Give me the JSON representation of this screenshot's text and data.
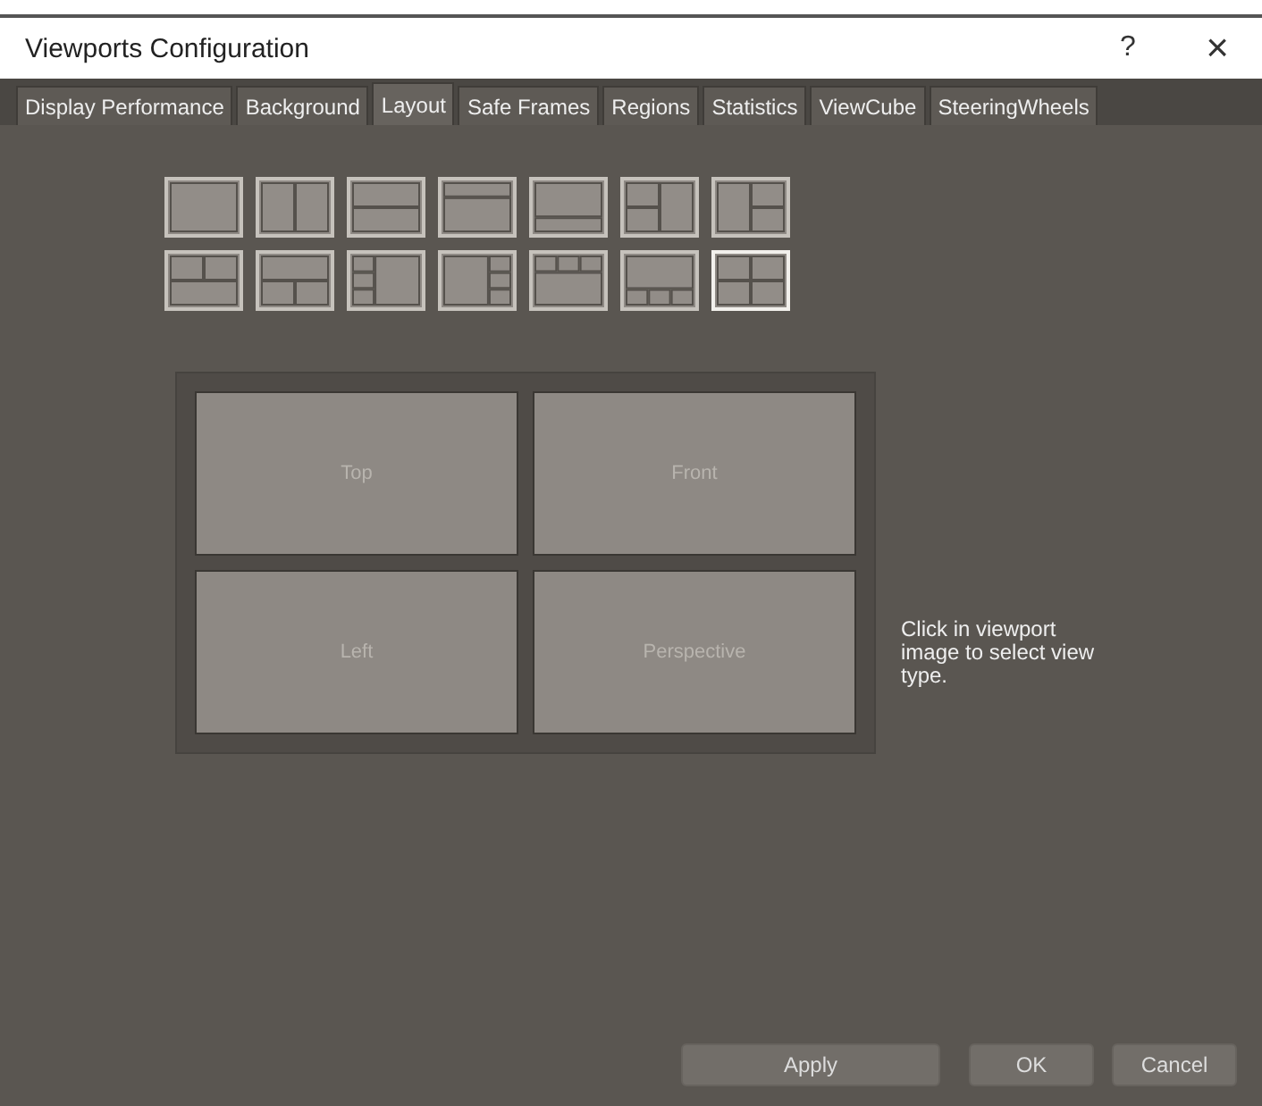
{
  "window": {
    "title": "Viewports Configuration",
    "help": "?",
    "close": "×"
  },
  "tabs": [
    {
      "label": "Display Performance",
      "selected": false
    },
    {
      "label": "Background",
      "selected": false
    },
    {
      "label": "Layout",
      "selected": true
    },
    {
      "label": "Safe Frames",
      "selected": false
    },
    {
      "label": "Regions",
      "selected": false
    },
    {
      "label": "Statistics",
      "selected": false
    },
    {
      "label": "ViewCube",
      "selected": false
    },
    {
      "label": "SteeringWheels",
      "selected": false
    }
  ],
  "layouts": [
    {
      "kind": "single",
      "selected": false
    },
    {
      "kind": "two-columns",
      "selected": false
    },
    {
      "kind": "two-rows",
      "selected": false
    },
    {
      "kind": "small-top",
      "selected": false
    },
    {
      "kind": "small-bottom",
      "selected": false
    },
    {
      "kind": "three-left",
      "selected": false
    },
    {
      "kind": "three-right",
      "selected": false
    },
    {
      "kind": "three-top",
      "selected": false
    },
    {
      "kind": "three-bottom",
      "selected": false
    },
    {
      "kind": "four-left",
      "selected": false
    },
    {
      "kind": "four-right",
      "selected": false
    },
    {
      "kind": "four-top",
      "selected": false
    },
    {
      "kind": "four-bottom",
      "selected": false
    },
    {
      "kind": "quad",
      "selected": true
    }
  ],
  "viewports": [
    {
      "label": "Top"
    },
    {
      "label": "Front"
    },
    {
      "label": "Left"
    },
    {
      "label": "Perspective"
    }
  ],
  "hint": "Click in viewport image to select view type.",
  "buttons": [
    "Apply",
    "OK",
    "Cancel"
  ]
}
